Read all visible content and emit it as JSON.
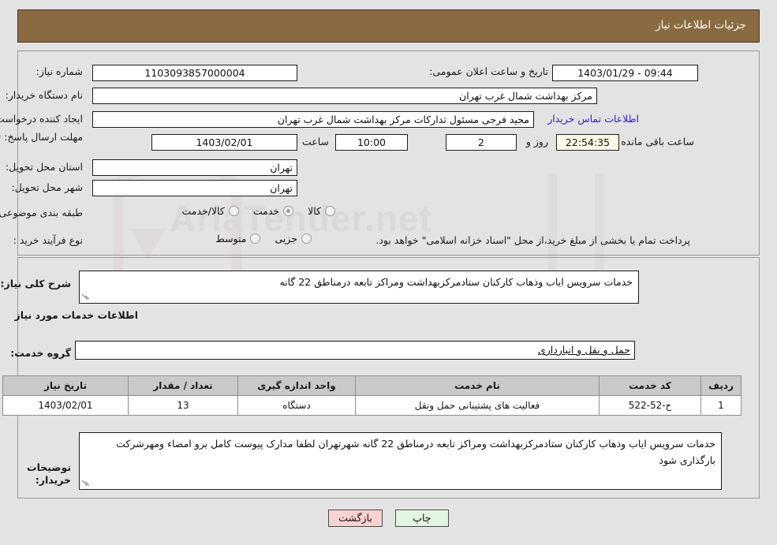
{
  "header": {
    "title": "جزئیات اطلاعات نیاز"
  },
  "colors": {
    "header_bg": "#8a6a42",
    "header_text": "#ffffff",
    "page_bg": "#e3e3e3",
    "link": "#2b20d8",
    "cream_field": "#fbfbe8",
    "back_button": "#fbd2d2",
    "print_button": "#e2f5e2",
    "table_header": "#c9c9c9"
  },
  "watermark": {
    "text": "AriaTender.net"
  },
  "summary": {
    "need_number_label": "شماره نیاز:",
    "need_number_value": "1103093857000004",
    "public_announce_label": "تاریخ و ساعت اعلان عمومی:",
    "public_announce_value": "09:44 - 1403/01/29",
    "buyer_org_label": "نام دستگاه خریدار:",
    "buyer_org_value": "مرکز بهداشت شمال غرب تهران",
    "requester_label": "ایجاد کننده درخواست:",
    "requester_value": "مجید فرجی مسئول تدارکات مرکز بهداشت شمال غرب تهران",
    "buyer_contact_link": "اطلاعات تماس خریدار",
    "deadline_label": "مهلت ارسال پاسخ: تا تاریخ:",
    "deadline_date": "1403/02/01",
    "deadline_time_label": "ساعت",
    "deadline_time_value": "10:00",
    "remaining_days_value": "2",
    "remaining_days_text": "روز و",
    "remaining_clock_value": "22:54:35",
    "remaining_clock_text": "ساعت باقی مانده",
    "province_label": "استان محل تحویل:",
    "province_value": "تهران",
    "city_label": "شهر محل تحویل:",
    "city_value": "تهران",
    "category_label": "طبقه بندی موضوعی:",
    "category_options": [
      {
        "label": "کالا",
        "selected": false
      },
      {
        "label": "خدمت",
        "selected": true
      },
      {
        "label": "کالا/خدمت",
        "selected": false
      }
    ],
    "process_label": "نوع فرآیند خرید :",
    "process_options": [
      {
        "label": "جزیی",
        "selected": false
      },
      {
        "label": "متوسط",
        "selected": false
      }
    ],
    "payment_note": "پرداخت تمام یا بخشی از مبلغ خرید،از محل \"اسناد خزانه اسلامی\" خواهد بود."
  },
  "need": {
    "general_desc_label": "شرح کلی نیاز:",
    "general_desc_value": "خدمات سرویس ایاب وذهاب کارکنان ستادمرکزبهداشت ومراکز تابعه درمناطق 22 گانه",
    "services_info_title": "اطلاعات خدمات مورد نیاز",
    "service_group_label": "گروه خدمت:",
    "service_group_value": "حمل و نقل و انبارداری"
  },
  "table": {
    "columns": [
      "ردیف",
      "کد خدمت",
      "نام خدمت",
      "واحد اندازه گیری",
      "تعداد / مقدار",
      "تاریخ نیاز"
    ],
    "rows": [
      {
        "row": "1",
        "service_code": "ح-52-522",
        "service_name": "فعالیت های پشتیبانی حمل ونقل",
        "unit": "دستگاه",
        "quantity": "13",
        "need_date": "1403/02/01"
      }
    ]
  },
  "buyer_notes": {
    "label": "توضیحات خریدار:",
    "value": "خدمات سرویس ایاب وذهاب کارکنان ستادمرکزبهداشت ومراکز تابعه درمناطق 22 گانه شهرتهران لطفا مدارک پیوست کامل برو امضاء ومهرشرکت بارگذاری شود"
  },
  "buttons": {
    "back": "بازگشت",
    "print": "چاپ"
  }
}
